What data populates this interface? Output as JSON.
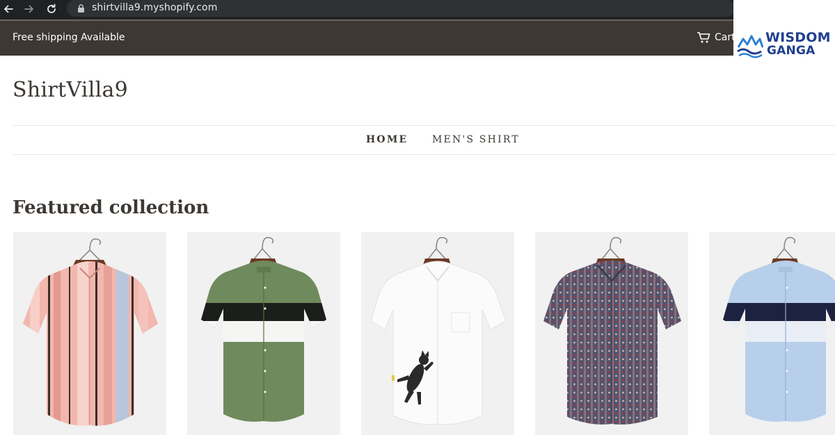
{
  "browser": {
    "url": "shirtvilla9.myshopify.com",
    "icons": [
      "back-arrow-icon",
      "forward-arrow-icon",
      "reload-icon",
      "lock-icon"
    ]
  },
  "announcement": {
    "text": "Free shipping Available",
    "cart_label": "Cart",
    "cart_icon": "cart-icon"
  },
  "watermark": {
    "line1": "WISDOM",
    "line2": "GANGA"
  },
  "store": {
    "title": "ShirtVilla9"
  },
  "menu": {
    "items": [
      {
        "label": "HOME",
        "active": true
      },
      {
        "label": "MEN'S SHIRT",
        "active": false
      }
    ]
  },
  "featured": {
    "title": "Featured collection",
    "products": [
      {
        "image": "pink-striped-shirt"
      },
      {
        "image": "green-colorblock-shirt"
      },
      {
        "image": "white-cat-print-shirt"
      },
      {
        "image": "patterned-print-shirt"
      },
      {
        "image": "blue-colorblock-shirt"
      }
    ]
  },
  "colors": {
    "announcement_bg": "#3d3834",
    "heading_text": "#3d3834",
    "card_bg": "#f1f1f1",
    "logo_blue": "#1f3f8f"
  }
}
